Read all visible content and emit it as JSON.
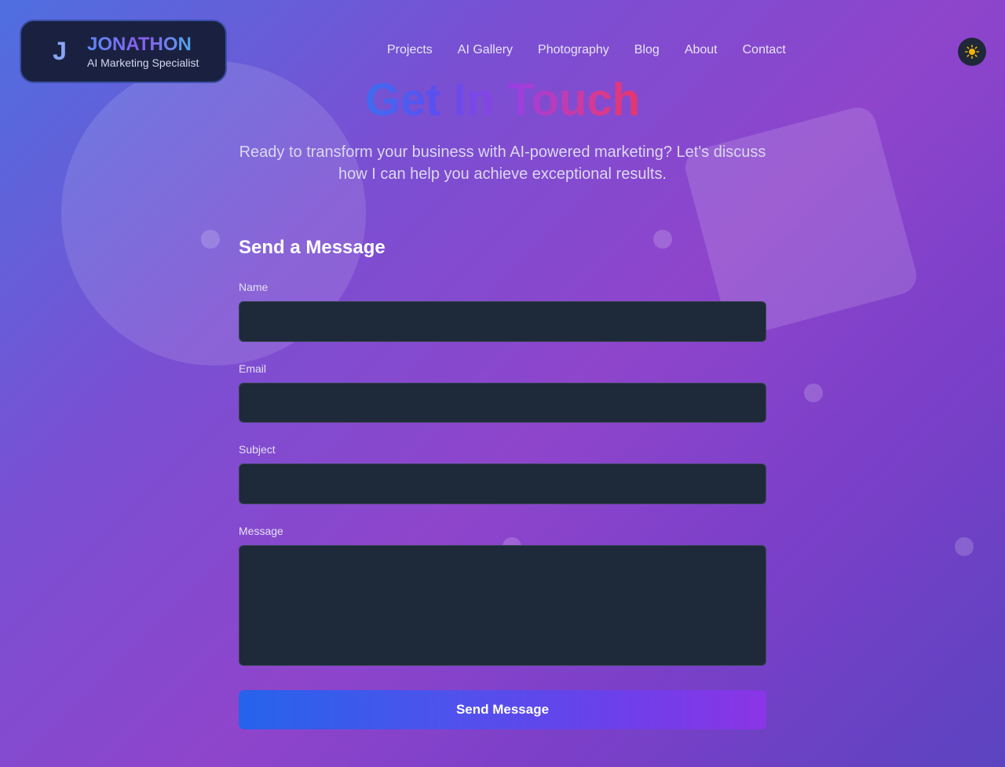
{
  "brand": {
    "initial": "J",
    "name": "JONATHON",
    "tagline": "AI Marketing Specialist"
  },
  "nav": {
    "items": [
      {
        "label": "Projects"
      },
      {
        "label": "AI Gallery"
      },
      {
        "label": "Photography"
      },
      {
        "label": "Blog"
      },
      {
        "label": "About"
      },
      {
        "label": "Contact"
      }
    ]
  },
  "theme_toggle": {
    "icon": "sun-icon",
    "icon_color": "#f5b400"
  },
  "hero": {
    "title": "Get In Touch",
    "subtitle": "Ready to transform your business with AI-powered marketing? Let's discuss how I can help you achieve exceptional results."
  },
  "form": {
    "title": "Send a Message",
    "name_label": "Name",
    "name_value": "",
    "email_label": "Email",
    "email_value": "",
    "subject_label": "Subject",
    "subject_value": "",
    "message_label": "Message",
    "message_value": "",
    "submit_label": "Send Message"
  }
}
